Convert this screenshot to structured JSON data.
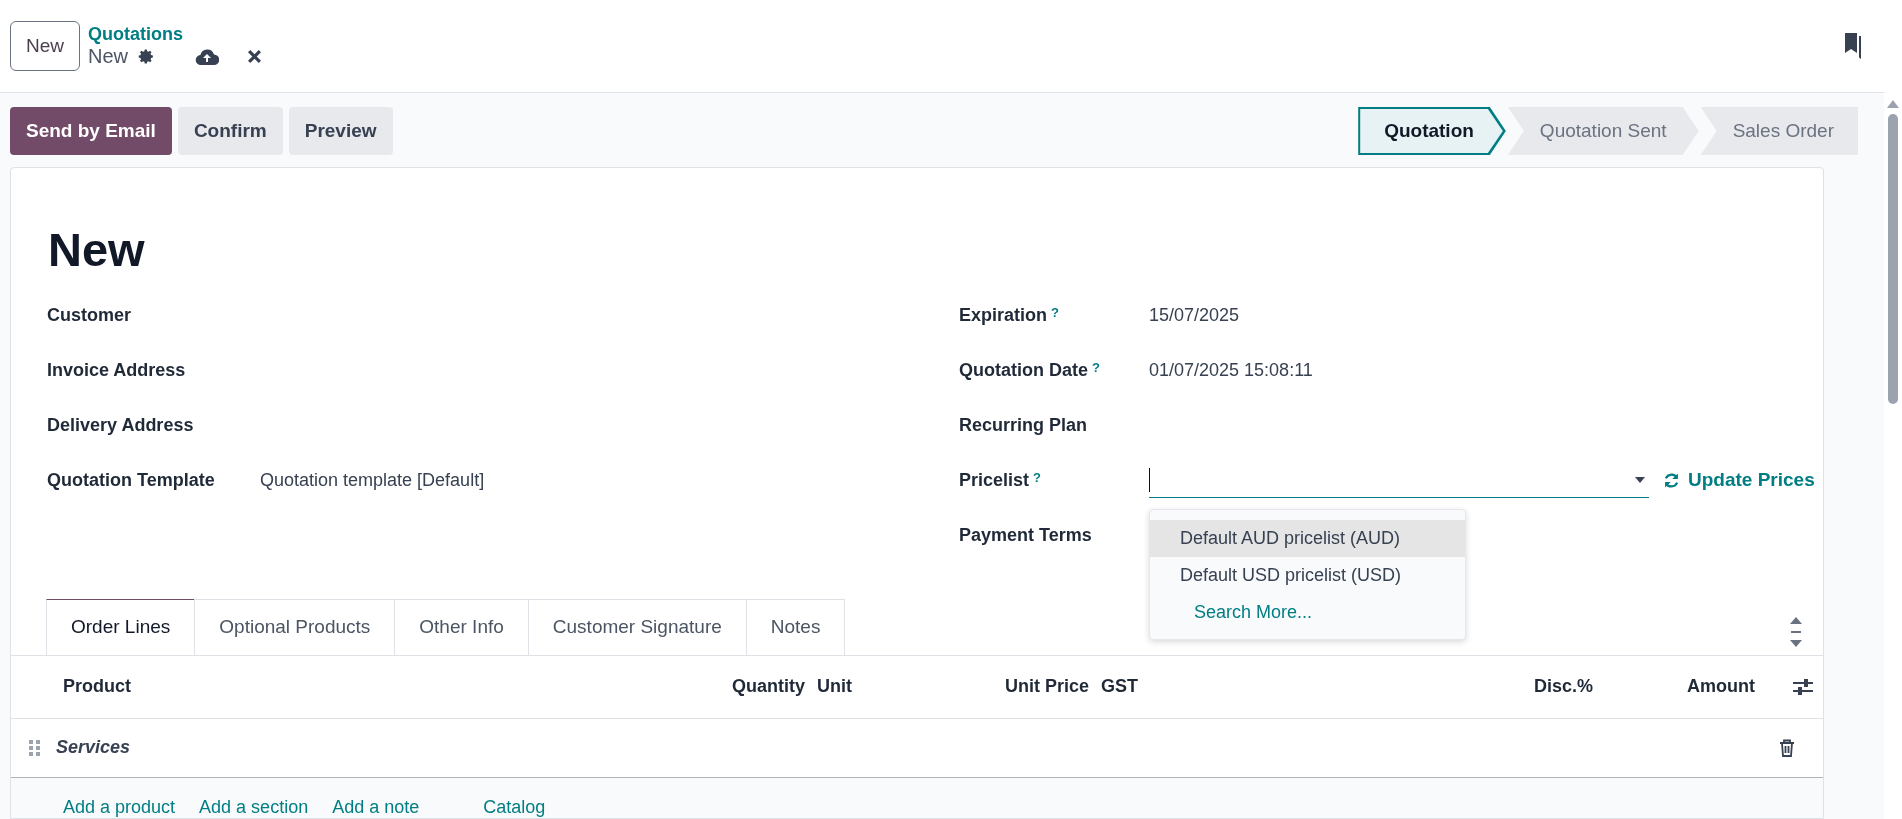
{
  "header": {
    "new_button": "New",
    "breadcrumb": "Quotations",
    "record_name": "New"
  },
  "actions": [
    {
      "label": "Send by Email",
      "kind": "primary"
    },
    {
      "label": "Confirm",
      "kind": "secondary"
    },
    {
      "label": "Preview",
      "kind": "secondary"
    }
  ],
  "status_steps": [
    {
      "label": "Quotation",
      "selected": true
    },
    {
      "label": "Quotation Sent",
      "selected": false
    },
    {
      "label": "Sales Order",
      "selected": false
    }
  ],
  "form": {
    "title": "New",
    "left_fields": [
      {
        "label": "Customer"
      },
      {
        "label": "Invoice Address"
      },
      {
        "label": "Delivery Address"
      },
      {
        "label": "Quotation Template",
        "value": "Quotation template [Default]"
      }
    ],
    "right_fields": [
      {
        "label": "Expiration",
        "help": "?",
        "kind": "text",
        "value": "15/07/2025"
      },
      {
        "label": "Quotation Date",
        "help": "?",
        "kind": "text",
        "value": "01/07/2025 15:08:11"
      },
      {
        "label": "Recurring Plan",
        "kind": "text"
      },
      {
        "label": "Pricelist",
        "help": "?",
        "kind": "dropdown",
        "action": "Update Prices",
        "options": [
          {
            "label": "Default AUD pricelist (AUD)",
            "selected": true
          },
          {
            "label": "Default USD pricelist (USD)",
            "selected": false
          }
        ],
        "search_more": "Search More..."
      },
      {
        "label": "Payment Terms",
        "kind": "text"
      }
    ]
  },
  "tabs": [
    {
      "label": "Order Lines",
      "selected": true
    },
    {
      "label": "Optional Products",
      "selected": false
    },
    {
      "label": "Other Info",
      "selected": false
    },
    {
      "label": "Customer Signature",
      "selected": false
    },
    {
      "label": "Notes",
      "selected": false
    }
  ],
  "table": {
    "columns": [
      {
        "label": "Product"
      },
      {
        "label": "Quantity"
      },
      {
        "label": "Unit"
      },
      {
        "label": "Unit Price"
      },
      {
        "label": "GST"
      },
      {
        "label": "Disc.%"
      },
      {
        "label": "Amount"
      }
    ],
    "rows": [
      {
        "kind": "section",
        "text": "Services"
      }
    ],
    "add_links": [
      "Add a product",
      "Add a section",
      "Add a note",
      "Catalog"
    ]
  }
}
